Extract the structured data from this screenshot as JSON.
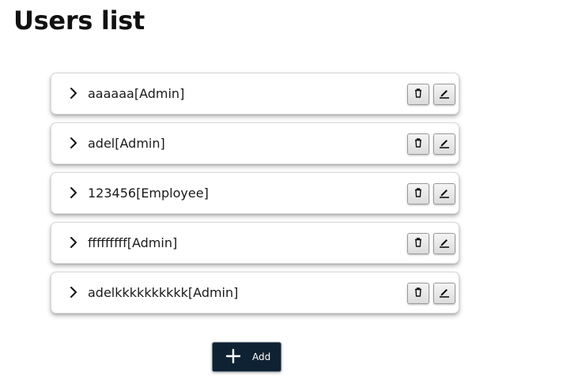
{
  "page": {
    "title": "Users list"
  },
  "users": [
    {
      "label": "aaaaaa[Admin]"
    },
    {
      "label": "adel[Admin]"
    },
    {
      "label": "123456[Employee]"
    },
    {
      "label": "fffffffff[Admin]"
    },
    {
      "label": "adelkkkkkkkkkk[Admin]"
    }
  ],
  "row_icons": {
    "expand": "chevron-right-icon",
    "delete": "trash-icon",
    "edit": "pencil-icon"
  },
  "add_button": {
    "label": "Add",
    "icon": "plus-icon"
  },
  "colors": {
    "add_button_bg": "#0f2233",
    "card_bg": "#ffffff",
    "action_button_bg": "#e6e6e6"
  }
}
